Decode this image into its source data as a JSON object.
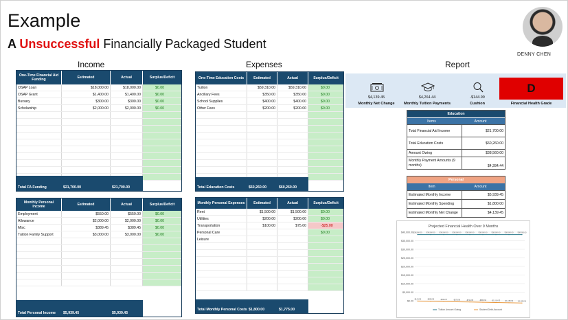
{
  "header": {
    "title": "Example",
    "subtitle_prefix": "A",
    "subtitle_highlight": "Unsuccessful",
    "subtitle_rest": "Financially Packaged Student",
    "author": "DENNY CHEN"
  },
  "sections": {
    "income": "Income",
    "expenses": "Expenses",
    "report": "Report"
  },
  "income_fa": {
    "headers": [
      "One-Time Financial Aid Funding",
      "Estimated",
      "Actual",
      "Surplus/Deficit"
    ],
    "rows": [
      [
        "OSAP Loan",
        "$18,000.00",
        "$18,000.00",
        "$0.00"
      ],
      [
        "OSAP Grant",
        "$1,400.00",
        "$1,400.00",
        "$0.00"
      ],
      [
        "Bursary",
        "$300.00",
        "$300.00",
        "$0.00"
      ],
      [
        "Scholarship",
        "$2,000.00",
        "$2,000.00",
        "$0.00"
      ]
    ],
    "total": [
      "Total FA Funding",
      "$21,700.00",
      "$21,700.00"
    ]
  },
  "income_personal": {
    "headers": [
      "Monthly Personal Income",
      "Estimated",
      "Actual",
      "Surplus/Deficit"
    ],
    "rows": [
      [
        "Employment",
        "$550.00",
        "$550.00",
        "$0.00"
      ],
      [
        "Allowance",
        "$2,000.00",
        "$2,000.00",
        "$0.00"
      ],
      [
        "Misc",
        "$389.45",
        "$389.45",
        "$0.00"
      ],
      [
        "Tuition Family Support",
        "$3,000.00",
        "$3,000.00",
        "$0.00"
      ]
    ],
    "total": [
      "Total Personal Income",
      "$5,939.45",
      "$5,939.45"
    ]
  },
  "expenses_edu": {
    "headers": [
      "One-Time Education Costs",
      "Estimated",
      "Actual",
      "Surplus/Deficit"
    ],
    "rows": [
      [
        "Tuition",
        "$59,310.00",
        "$59,310.00",
        "$0.00"
      ],
      [
        "Ancillary Fees",
        "$350.00",
        "$350.00",
        "$0.00"
      ],
      [
        "School Supplies",
        "$400.00",
        "$400.00",
        "$0.00"
      ],
      [
        "Other Fees",
        "$200.00",
        "$200.00",
        "$0.00"
      ]
    ],
    "total": [
      "Total Education Costs",
      "$60,260.00",
      "$60,260.00"
    ]
  },
  "expenses_personal": {
    "headers": [
      "Monthly Personal Expenses",
      "Estimated",
      "Actual",
      "Surplus/Deficit"
    ],
    "rows": [
      [
        "Rent",
        "$1,500.00",
        "$1,500.00",
        "$0.00"
      ],
      [
        "Utilities",
        "$200.00",
        "$200.00",
        "$0.00"
      ],
      [
        "Transportation",
        "$100.00",
        "$75.00",
        "-$25.00"
      ],
      [
        "Personal Care",
        "",
        "",
        "$0.00"
      ],
      [
        "Leisure",
        "",
        "",
        ""
      ]
    ],
    "total": [
      "Total Monthly Personal Costs",
      "$1,800.00",
      "$1,775.00"
    ]
  },
  "report": {
    "kpis": [
      {
        "icon": "money-icon",
        "value": "$4,139.45",
        "label": "Monthly Net Change"
      },
      {
        "icon": "graduation-cap-icon",
        "value": "$4,264.44",
        "label": "Monthly Tuition Payments"
      },
      {
        "icon": "magnifier-icon",
        "value": "-$144.99",
        "label": "Cushion"
      }
    ],
    "grade": "D",
    "grade_label": "Financial Health Grade",
    "grade_color": "#e00000",
    "education": {
      "title": "Education",
      "cols": [
        "Items",
        "Amount"
      ],
      "rows": [
        [
          "Total Financial Aid Income",
          "$21,700.00"
        ],
        [
          "Total Education Costs",
          "$60,260.00"
        ],
        [
          "Amount Owing",
          "$38,560.00"
        ],
        [
          "Monthly Payment Amounts (9 months)",
          "$4,284.44"
        ]
      ]
    },
    "personal": {
      "title": "Personal",
      "cols": [
        "Item",
        "Amount"
      ],
      "rows": [
        [
          "Estimated Monthly Income",
          "$5,939.45"
        ],
        [
          "Estimated Monthly Spending",
          "$1,800.00"
        ],
        [
          "Estimated Monthly Net Change",
          "$4,139.45"
        ]
      ]
    }
  },
  "chart_data": {
    "type": "line",
    "title": "Projected Financial Health Over 9 Months",
    "ylim": [
      0,
      40000
    ],
    "yticks": [
      "$0.00",
      "$5,000.00",
      "$10,000.00",
      "$15,000.00",
      "$20,000.00",
      "$25,000.00",
      "$30,000.00",
      "$35,000.00",
      "$40,000.00"
    ],
    "x": [
      1,
      2,
      3,
      4,
      5,
      6,
      7,
      8,
      9
    ],
    "series": [
      {
        "name": "Tuition Amount Owing",
        "color": "#2a7a8c",
        "values": [
          38560,
          38560,
          38560,
          38560,
          38560,
          38560,
          38560,
          38560,
          38560
        ],
        "labels": [
          "$38,560.00",
          "$38,560.00",
          "$38,560.00",
          "$38,560.00",
          "$38,560.00",
          "$38,560.00",
          "$38,560.00",
          "$38,560.00",
          "$38,560.00"
        ]
      },
      {
        "name": "Student Debt Account",
        "color": "#e8963a",
        "values": [
          -144.99,
          -289.98,
          -434.97,
          -579.96,
          -724.95,
          -869.94,
          -1014.93,
          -1159.92,
          -1304.91
        ],
        "labels": [
          "-$144.99",
          "-$289.98",
          "-$434.97",
          "-$579.96",
          "-$724.95",
          "-$869.94",
          "-$1,014.93",
          "-$1,159.92",
          "-$1,304.91"
        ]
      }
    ],
    "grid": true,
    "legend": "bottom"
  }
}
